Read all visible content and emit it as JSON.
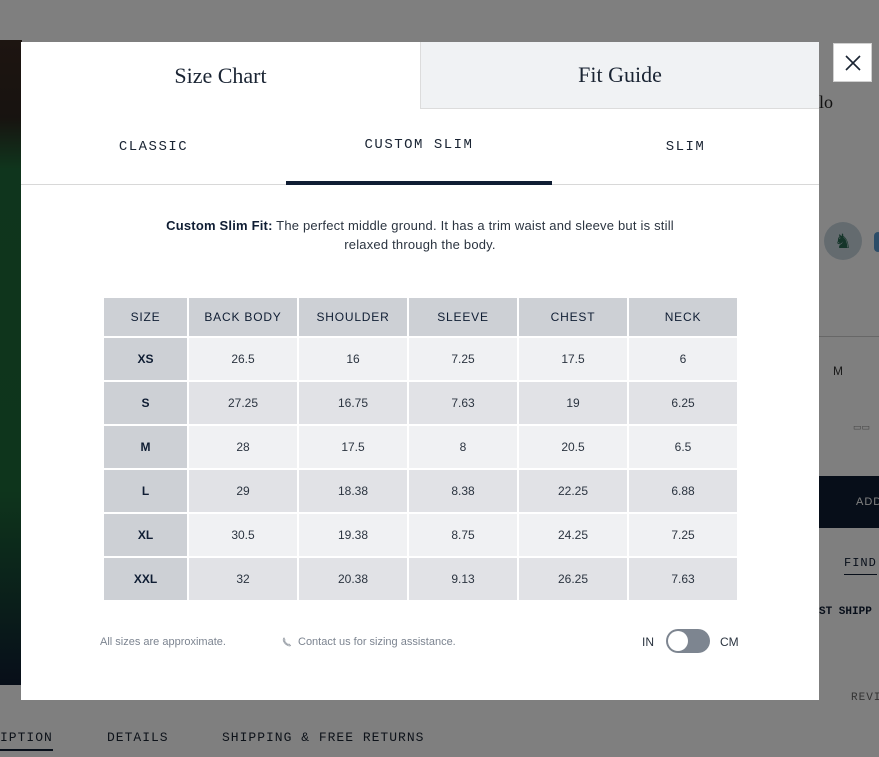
{
  "background": {
    "title_fragment": "lo",
    "size_m": "M",
    "add_button": "ADD",
    "find_link": "FIND",
    "shipping_fragment": "ST SHIPP",
    "reviews_fragment": "REVI",
    "tabs": [
      "IPTION",
      "DETAILS",
      "SHIPPING & FREE RETURNS"
    ]
  },
  "modal": {
    "tabs": {
      "size_chart": "Size Chart",
      "fit_guide": "Fit Guide"
    },
    "fit_tabs": [
      "CLASSIC",
      "CUSTOM SLIM",
      "SLIM"
    ],
    "active_fit": "CUSTOM SLIM",
    "description": {
      "label": "Custom Slim Fit:",
      "text": " The perfect middle ground. It has a trim waist and sleeve but is still relaxed through the body."
    },
    "table": {
      "headers": [
        "SIZE",
        "BACK BODY",
        "SHOULDER",
        "SLEEVE",
        "CHEST",
        "NECK"
      ],
      "rows": [
        [
          "XS",
          "26.5",
          "16",
          "7.25",
          "17.5",
          "6"
        ],
        [
          "S",
          "27.25",
          "16.75",
          "7.63",
          "19",
          "6.25"
        ],
        [
          "M",
          "28",
          "17.5",
          "8",
          "20.5",
          "6.5"
        ],
        [
          "L",
          "29",
          "18.38",
          "8.38",
          "22.25",
          "6.88"
        ],
        [
          "XL",
          "30.5",
          "19.38",
          "8.75",
          "24.25",
          "7.25"
        ],
        [
          "XXL",
          "32",
          "20.38",
          "9.13",
          "26.25",
          "7.63"
        ]
      ]
    },
    "footer": {
      "approx": "All sizes are approximate.",
      "contact": "Contact us for sizing assistance.",
      "unit_in": "IN",
      "unit_cm": "CM",
      "unit_selected": "IN"
    }
  },
  "colors": {
    "navy": "#0f1d33",
    "header_cell": "#cdd0d5",
    "overlay": "rgba(0,0,0,0.5)"
  },
  "icons": {
    "close": "close-icon",
    "phone": "phone-icon",
    "logo": "polo-pony-icon"
  }
}
